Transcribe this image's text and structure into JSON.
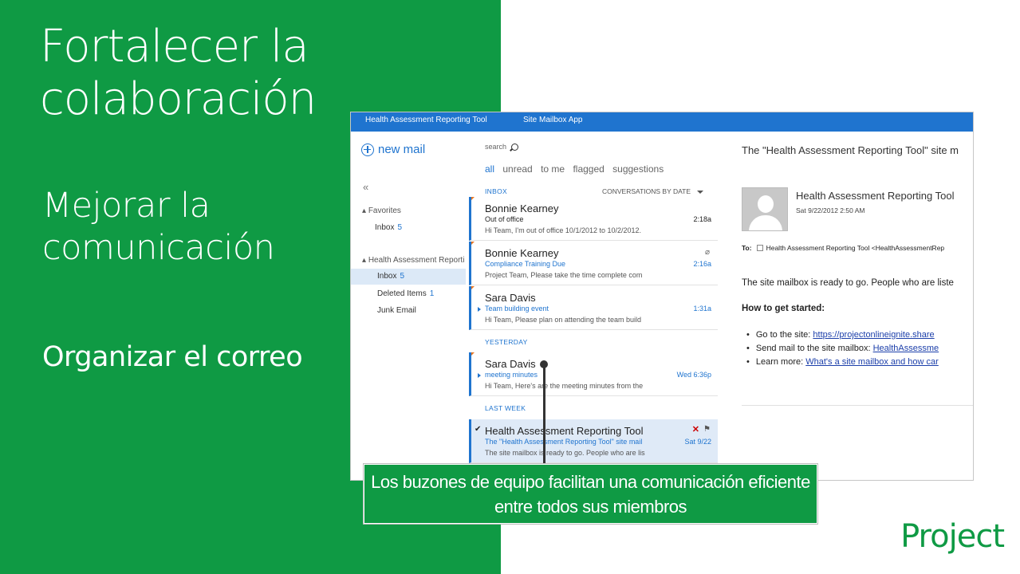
{
  "slide": {
    "title": "Fortalecer la colaboración",
    "subheading": "Mejorar la comunicación",
    "bold_heading": "Organizar el correo",
    "callout": "Los buzones de equipo facilitan una comunicación eficiente entre todos sus miembros",
    "brand": "Project",
    "accent_color": "#0f9a44"
  },
  "app": {
    "tabs": [
      "Health Assessment Reporting Tool",
      "Site Mailbox App"
    ],
    "topbar_color": "#1f74cf",
    "new_mail_label": "new mail",
    "collapse_icon": "«",
    "favorites": {
      "group_label": "Favorites",
      "items": [
        {
          "label": "Inbox",
          "count": "5"
        }
      ]
    },
    "mailbox": {
      "group_label": "Health Assessment Reporti",
      "items": [
        {
          "label": "Inbox",
          "count": "5"
        },
        {
          "label": "Deleted Items",
          "count": "1"
        },
        {
          "label": "Junk Email",
          "count": ""
        }
      ]
    }
  },
  "list": {
    "search_placeholder": "search",
    "filters": [
      "all",
      "unread",
      "to me",
      "flagged",
      "suggestions"
    ],
    "inbox_label": "INBOX",
    "sort_label": "CONVERSATIONS BY DATE",
    "yesterday_label": "YESTERDAY",
    "last_week_label": "LAST WEEK",
    "messages": [
      {
        "sender": "Bonnie Kearney",
        "subject": "Out of office",
        "preview": "Hi Team, I'm out of office 10/1/2012 to 10/2/2012.",
        "time": "2:18a"
      },
      {
        "sender": "Bonnie Kearney",
        "subject": "Compliance Training Due",
        "preview": "Project Team, Please take the time complete com",
        "time": "2:16a"
      },
      {
        "sender": "Sara Davis",
        "subject": "Team building event",
        "preview": "Hi Team, Please plan on attending the team build",
        "time": "1:31a"
      },
      {
        "sender": "Sara Davis",
        "subject": "meeting minutes",
        "preview": "Hi Team, Here's are the meeting minutes from the",
        "time": "Wed 6:36p"
      },
      {
        "sender": "Health Assessment Reporting Tool",
        "subject": "The \"Health Assessment Reporting Tool\" site mail",
        "preview": "The site mailbox is ready to go. People who are lis",
        "time": "Sat 9/22"
      }
    ]
  },
  "reading": {
    "subject": "The \"Health Assessment Reporting Tool\" site m",
    "from_name": "Health Assessment Reporting Tool",
    "from_date": "Sat 9/22/2012 2:50 AM",
    "to_label": "To:",
    "to_value": "Health Assessment Reporting Tool <HealthAssessmentRep",
    "body_line": "The site mailbox is ready to go. People who are liste",
    "how_heading": "How to get started:",
    "bullets": [
      {
        "text": "Go to the site: ",
        "link": "https://projectonlineignite.share"
      },
      {
        "text": "Send mail to the site mailbox: ",
        "link": "HealthAssessme"
      },
      {
        "text": "Learn more: ",
        "link": "What's a site mailbox and how car"
      }
    ]
  }
}
